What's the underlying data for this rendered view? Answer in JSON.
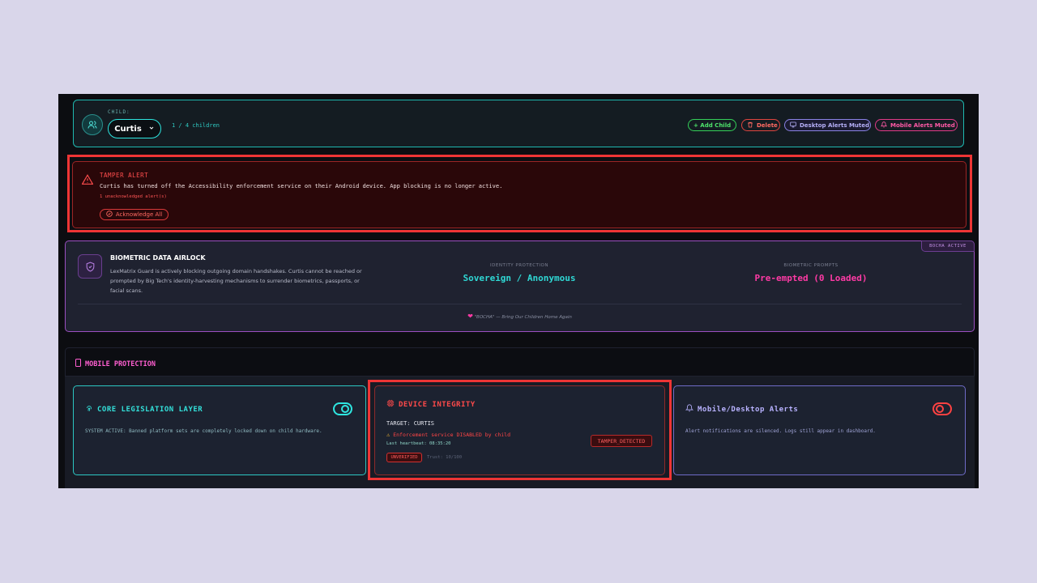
{
  "child_bar": {
    "label": "CHILD:",
    "selected_child": "Curtis",
    "count": "1 / 4 children",
    "add_label": "+ Add Child",
    "delete_label": "Delete",
    "desktop_label": "Desktop Alerts Muted",
    "mobile_label": "Mobile Alerts Muted"
  },
  "tamper_alert": {
    "title": "TAMPER ALERT",
    "message": "Curtis has turned off the Accessibility enforcement service on their Android device. App blocking is no longer active.",
    "count": "1 unacknowledged alert(s)",
    "ack_label": "Acknowledge All"
  },
  "biometric": {
    "badge": "BOCHA ACTIVE",
    "title": "BIOMETRIC DATA AIRLOCK",
    "description": "LexMatrix Guard is actively blocking outgoing domain handshakes. Curtis cannot be reached or prompted by Big Tech's identity-harvesting mechanisms to surrender biometrics, passports, or facial scans.",
    "identity_label": "IDENTITY PROTECTION",
    "identity_value": "Sovereign / Anonymous",
    "prompts_label": "BIOMETRIC PROMPTS",
    "prompts_value": "Pre-empted (0 Loaded)",
    "footer": "\"BOCHA\" — Bring Our Children Home Again"
  },
  "mobile": {
    "header": "MOBILE PROTECTION",
    "core": {
      "title": "CORE LEGISLATION LAYER",
      "description": "SYSTEM ACTIVE: Banned platform sets are completely locked down on child hardware.",
      "enabled": true
    },
    "device": {
      "title": "DEVICE INTEGRITY",
      "target": "TARGET: CURTIS",
      "warning": "Enforcement service DISABLED by child",
      "heartbeat": "Last heartbeat: 08:35:20",
      "status_badge": "UNVERIFIED",
      "trust": "Trust: 10/100",
      "tamper_badge": "TAMPER_DETECTED"
    },
    "alerts": {
      "title": "Mobile/Desktop Alerts",
      "description": "Alert notifications are silenced. Logs still appear in dashboard.",
      "enabled": false
    }
  },
  "colors": {
    "accent_cyan": "#2ee6e0",
    "alert_red": "#ff4a4a",
    "accent_pink": "#ff3aa5",
    "accent_purple": "#9b4fc0"
  }
}
